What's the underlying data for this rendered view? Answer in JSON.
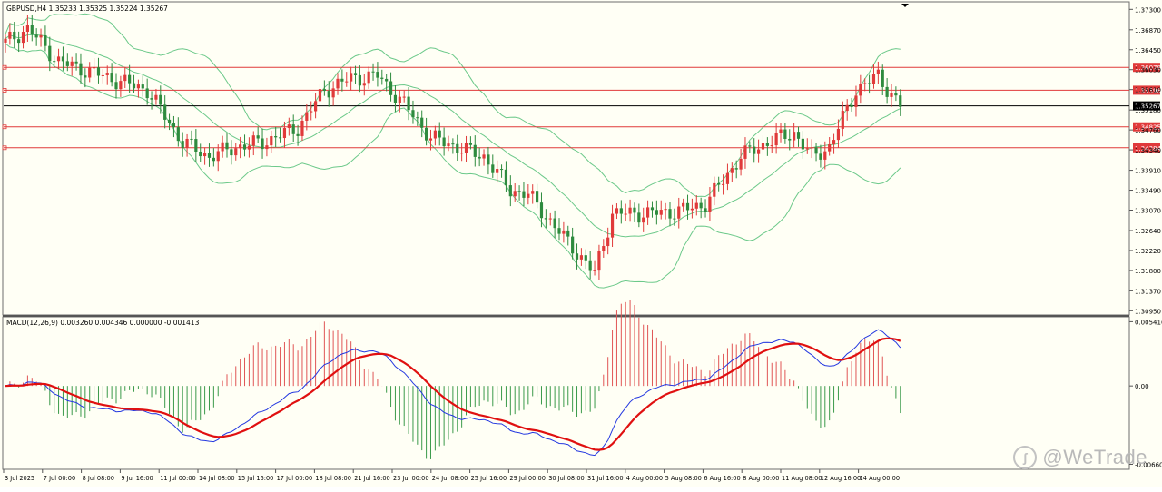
{
  "main_chart": {
    "info_label": "GBPUSD,H4  1.35233 1.35325 1.35224 1.35267",
    "price_axis_labels": [
      "1.37300",
      "1.36870",
      "1.36450",
      "1.36030",
      "1.35610",
      "1.35180",
      "1.34760",
      "1.34340",
      "1.33910",
      "1.33490",
      "1.33070",
      "1.32640",
      "1.32220",
      "1.31800",
      "1.31370",
      "1.30950"
    ],
    "horizontal_levels": [
      {
        "price": 1.36078,
        "label": "1.36078",
        "color": "#e03a3a"
      },
      {
        "price": 1.35596,
        "label": "1.35596",
        "color": "#e03a3a"
      },
      {
        "price": 1.34825,
        "label": "1.34825",
        "color": "#e03a3a"
      },
      {
        "price": 1.34384,
        "label": "1.34384",
        "color": "#e03a3a"
      }
    ],
    "current_price": {
      "price": 1.35267,
      "label": "1.35267",
      "color": "#000000"
    },
    "colors": {
      "bull": "#e03a3a",
      "bear": "#2e8b3e",
      "bands": "#6cc98a",
      "level": "#e03a3a"
    }
  },
  "macd_panel": {
    "info_label": "MACD(12,26,9) 0.003260 0.004346 0.000000 -0.001413",
    "axis_labels": [
      "0.005416",
      "0.00",
      "-0.006609"
    ],
    "colors": {
      "main": "#2438e0",
      "signal": "#e01010",
      "hist_pos": "#e05555",
      "hist_neg": "#3a9a4a"
    }
  },
  "time_axis": {
    "labels": [
      "3 Jul 2025",
      "7 Jul 00:00",
      "8 Jul 08:00",
      "9 Jul 16:00",
      "11 Jul 00:00",
      "14 Jul 08:00",
      "15 Jul 16:00",
      "17 Jul 00:00",
      "18 Jul 08:00",
      "21 Jul 16:00",
      "23 Jul 00:00",
      "24 Jul 08:00",
      "25 Jul 16:00",
      "29 Jul 00:00",
      "30 Jul 08:00",
      "31 Jul 16:00",
      "4 Aug 00:00",
      "5 Aug 08:00",
      "6 Aug 16:00",
      "8 Aug 00:00",
      "11 Aug 08:00",
      "12 Aug 16:00",
      "14 Aug 00:00"
    ]
  },
  "watermark": {
    "text": "@WeTrade",
    "icon": "wetrade-logo-icon"
  }
}
